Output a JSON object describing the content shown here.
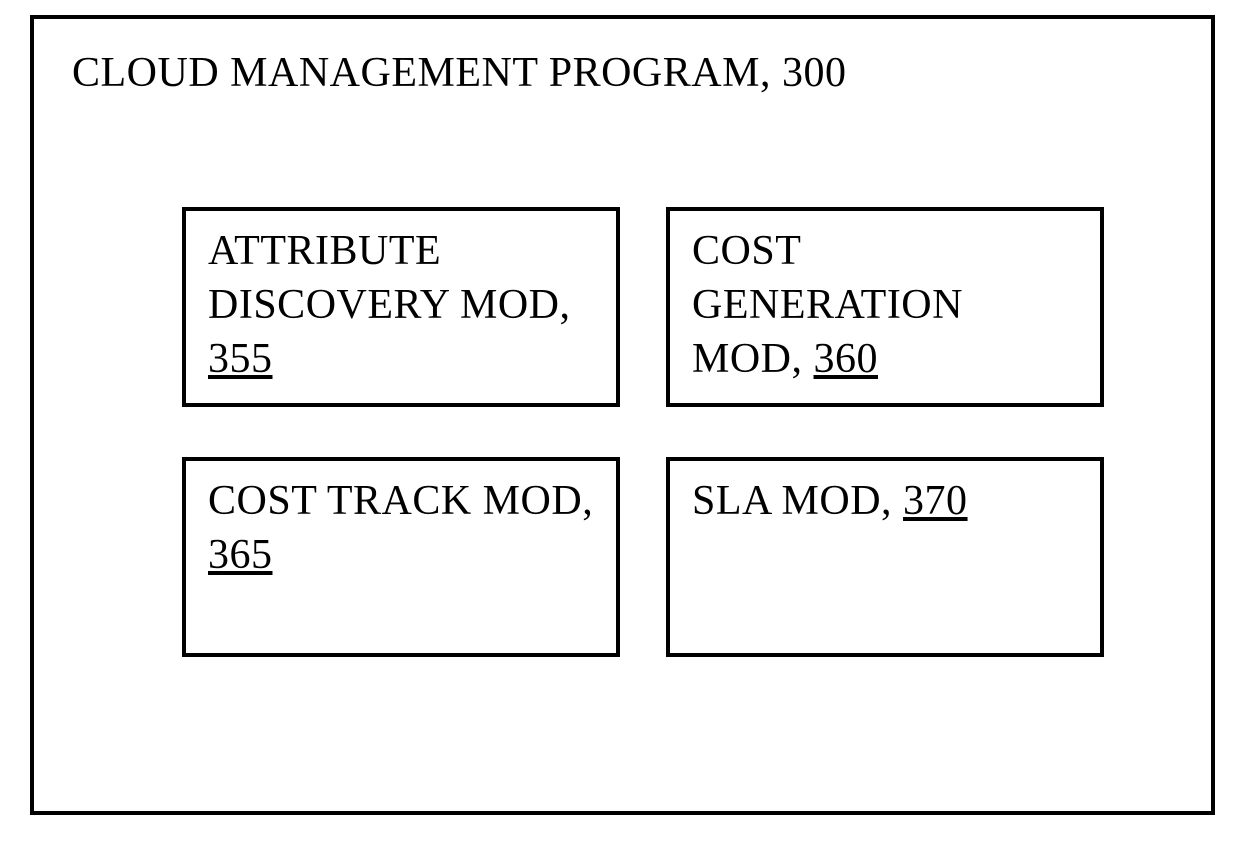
{
  "header": {
    "title": "CLOUD MANAGEMENT PROGRAM, 300"
  },
  "modules": {
    "attribute_discovery": {
      "label": "ATTRIBUTE DISCOVERY MOD, ",
      "ref": "355"
    },
    "cost_generation": {
      "label": "COST GENERATION MOD, ",
      "ref": "360"
    },
    "cost_track": {
      "label": "COST TRACK MOD, ",
      "ref": "365"
    },
    "sla": {
      "label": "SLA MOD, ",
      "ref": "370"
    }
  }
}
